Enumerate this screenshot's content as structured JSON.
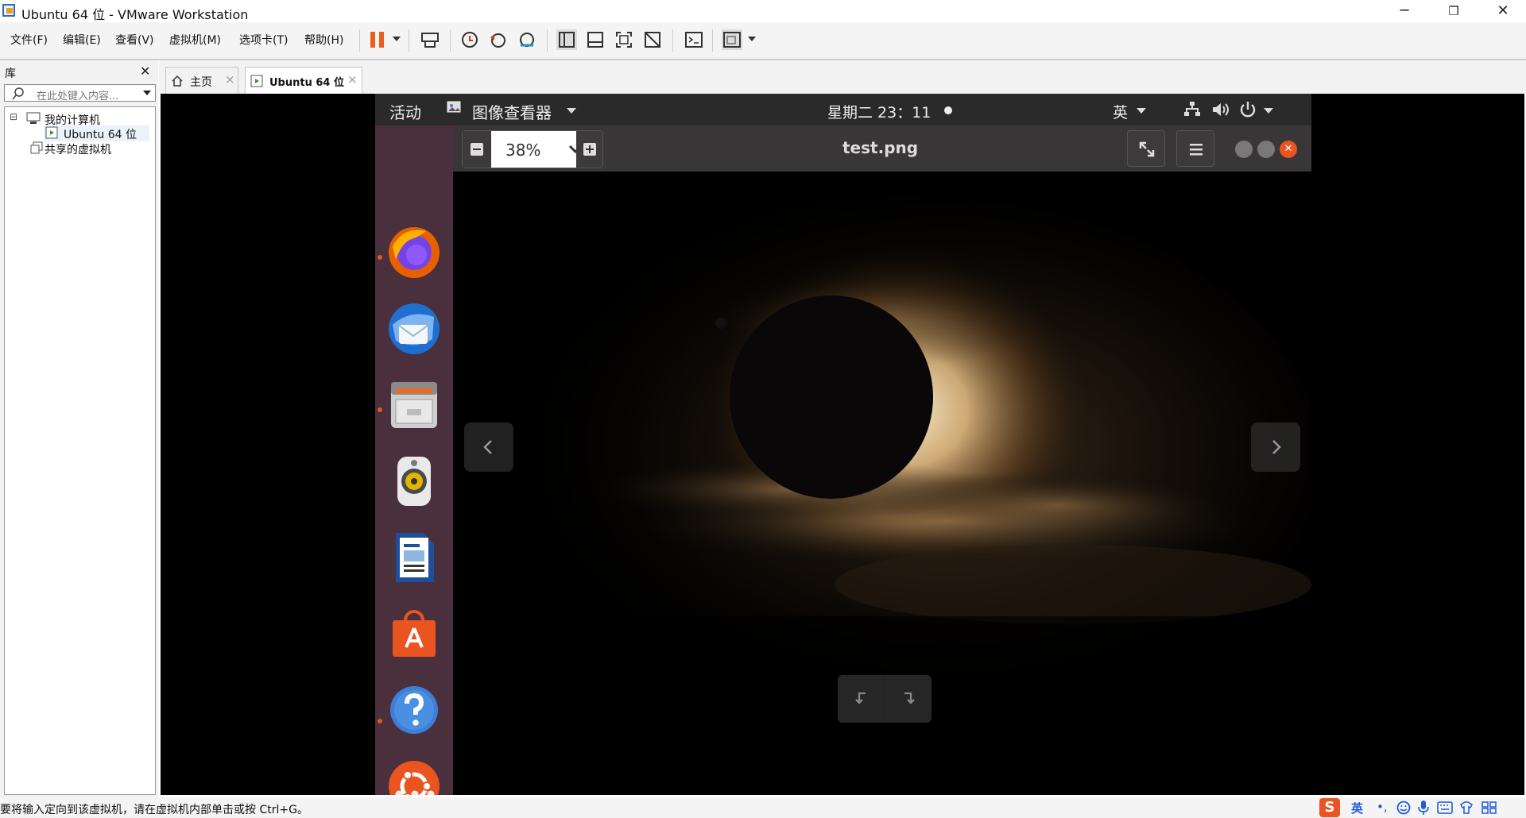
{
  "window": {
    "title": "Ubuntu 64 位 - VMware Workstation",
    "minimize": "─",
    "restore": "❐",
    "close": "✕"
  },
  "menu": [
    "文件(F)",
    "编辑(E)",
    "查看(V)",
    "虚拟机(M)",
    "选项卡(T)",
    "帮助(H)"
  ],
  "library": {
    "title": "库",
    "close": "✕",
    "search_placeholder": "在此处键入内容...",
    "tree": {
      "my_computer": "我的计算机",
      "vm": "Ubuntu 64 位",
      "shared": "共享的虚拟机",
      "expander": "⊟"
    }
  },
  "tabs": {
    "home": "主页",
    "vm": "Ubuntu 64 位",
    "close": "×"
  },
  "ubuntu": {
    "activities": "活动",
    "app_menu": "图像查看器",
    "clock": "星期二 23：11",
    "input_method": "英",
    "viewer": {
      "zoom": "38%",
      "filename": "test.png",
      "zoom_out": "−",
      "zoom_in": "+"
    }
  },
  "status": {
    "message": "要将输入定向到该虚拟机，请在虚拟机内部单击或按 Ctrl+G。",
    "ime": "英"
  },
  "colors": {
    "ubuntu_orange": "#E95420",
    "dock_bg": "#4A2F3C",
    "topbar_bg": "#2B2A2A",
    "pause_orange": "#E8601C"
  }
}
